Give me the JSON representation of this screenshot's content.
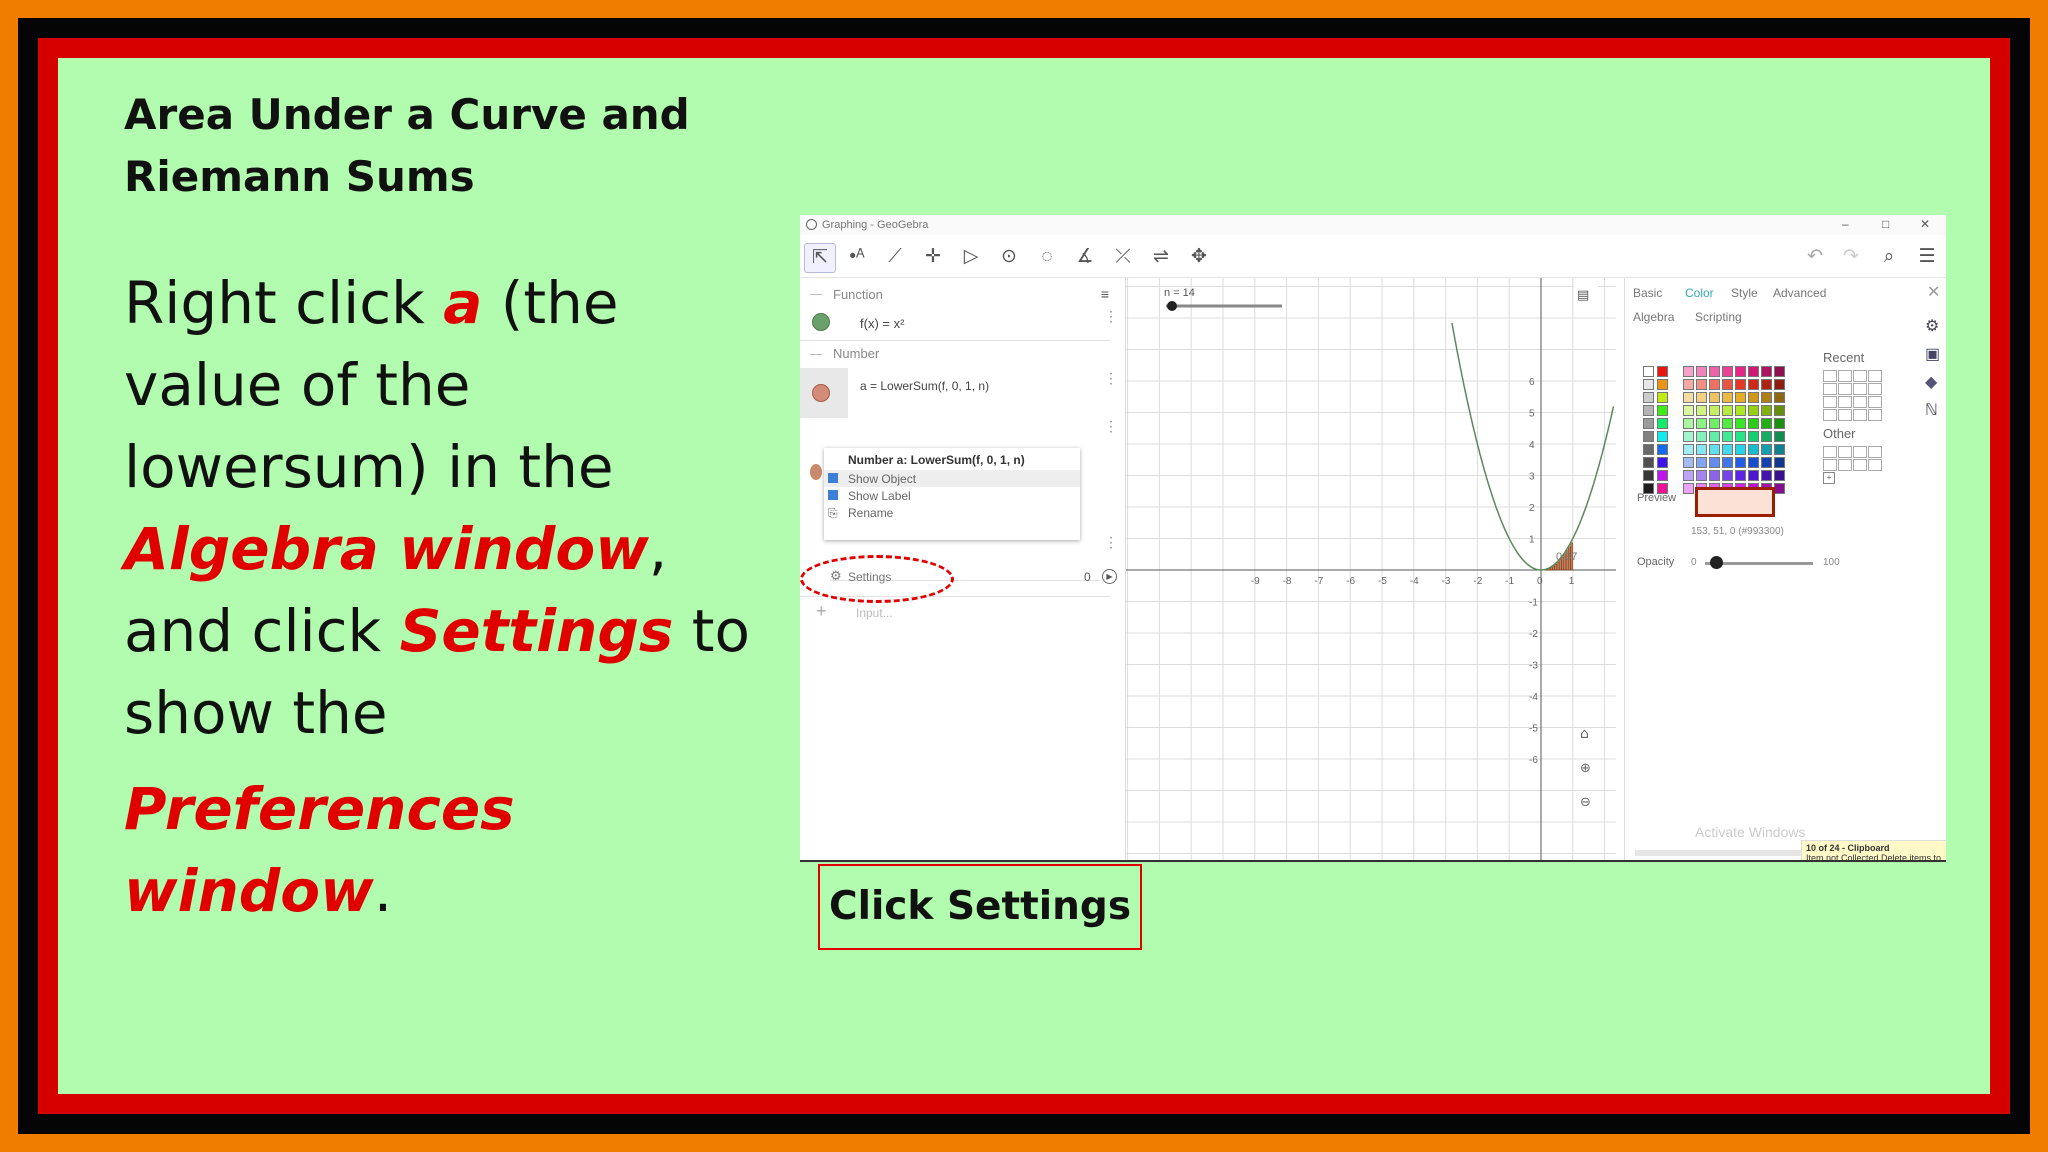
{
  "slide": {
    "title_line1": "Area Under a Curve and",
    "title_line2": "Riemann Sums",
    "body": {
      "t1": "Right click ",
      "h1": "a",
      "t2": " (the value of the lowersum) in the ",
      "h2": "Algebra window",
      "t3": ", and click ",
      "h3": "Settings",
      "t4": " to show the",
      "h4": "Preferences window",
      "t5": "."
    },
    "caption": "Click Settings"
  },
  "app": {
    "window_title": "Graphing - GeoGebra",
    "window_controls": [
      "–",
      "□",
      "✕"
    ]
  },
  "algebra": {
    "function_header": "Function",
    "function_expr": "f(x) = x²",
    "number_header": "Number",
    "number_expr": "a = LowerSum(f, 0, 1, n)",
    "context_menu": {
      "title": "Number a: LowerSum(f, 0, 1, n)",
      "items": [
        "Show Object",
        "Show Label",
        "Rename",
        "Settings"
      ]
    },
    "value_zero": "0",
    "input_placeholder": "Input..."
  },
  "graphics": {
    "slider_label": "n = 14",
    "value_label": "0.37",
    "x_ticks": [
      "-9",
      "-8",
      "-7",
      "-6",
      "-5",
      "-4",
      "-3",
      "-2",
      "-1",
      "0",
      "1"
    ],
    "y_ticks": [
      "6",
      "5",
      "4",
      "3",
      "2",
      "1",
      "-1",
      "-2",
      "-3",
      "-4",
      "-5",
      "-6"
    ]
  },
  "settings": {
    "tabs": [
      "Basic",
      "Color",
      "Style",
      "Advanced",
      "Algebra",
      "Scripting"
    ],
    "active_tab": "Color",
    "recent_label": "Recent",
    "other_label": "Other",
    "preview_label": "Preview",
    "color_value": "153, 51, 0 (#993300)",
    "opacity_label": "Opacity",
    "opacity_min": "0",
    "opacity_max": "100",
    "opacity_value": 0.1,
    "watermark": "Activate Windows",
    "toast_title": "10 of 24 - Clipboard",
    "toast_body": "Item not Collected Delete items to increase available space"
  },
  "colors": {
    "slide_bg": "#b1fcae",
    "orange": "#f07d00",
    "red": "#d60000",
    "highlight": "#e00000",
    "curve": "#5a8a5a",
    "fill": "#b75f2f"
  }
}
